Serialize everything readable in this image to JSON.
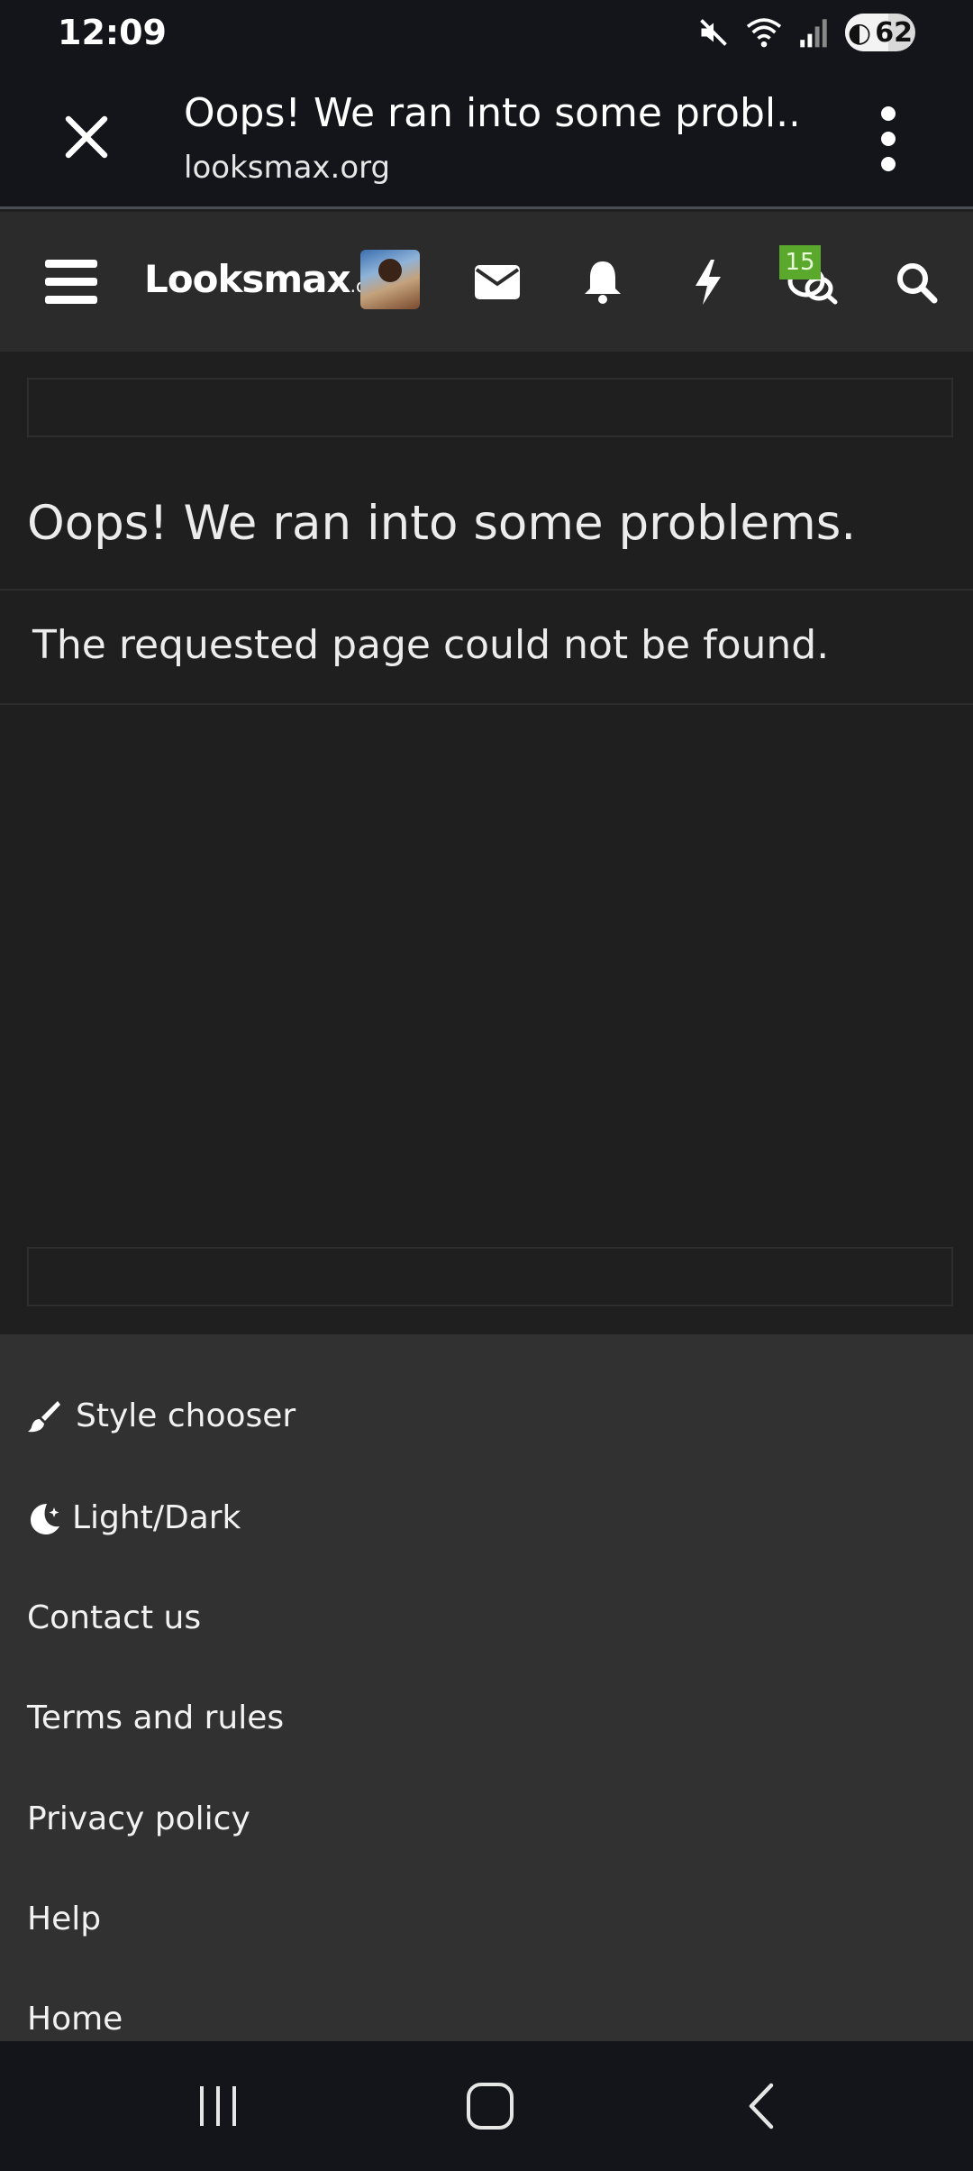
{
  "status_bar": {
    "time": "12:09",
    "battery_level": "62",
    "icons": [
      "mute-icon",
      "wifi-icon",
      "signal-icon",
      "battery-saver-icon"
    ]
  },
  "browser": {
    "page_title": "Oops! We ran into some probl...",
    "url": "looksmax.org",
    "icons": [
      "close-icon",
      "more-options-icon"
    ]
  },
  "site_nav": {
    "logo_main": "Looksmax",
    "logo_suffix": ".org",
    "conversations_badge": "15",
    "icons": [
      "menu-icon",
      "avatar",
      "envelope-icon",
      "bell-icon",
      "bolt-icon",
      "chat-icon",
      "search-icon"
    ]
  },
  "content": {
    "title": "Oops! We ran into some problems.",
    "message": "The requested page could not be found."
  },
  "footer": {
    "items": [
      {
        "label": "Style chooser",
        "icon": "paintbrush-icon"
      },
      {
        "label": "Light/Dark",
        "icon": "moon-stars-icon"
      },
      {
        "label": "Contact us"
      },
      {
        "label": "Terms and rules"
      },
      {
        "label": "Privacy policy"
      },
      {
        "label": "Help"
      },
      {
        "label": "Home"
      }
    ]
  },
  "system_nav": {
    "icons": [
      "recent-apps-icon",
      "home-icon",
      "back-icon"
    ]
  },
  "colors": {
    "background": "#1f1f1f",
    "toolbar": "#13151a",
    "nav": "#2b2b2b",
    "footer": "#313131",
    "badge": "#5aa82c"
  }
}
